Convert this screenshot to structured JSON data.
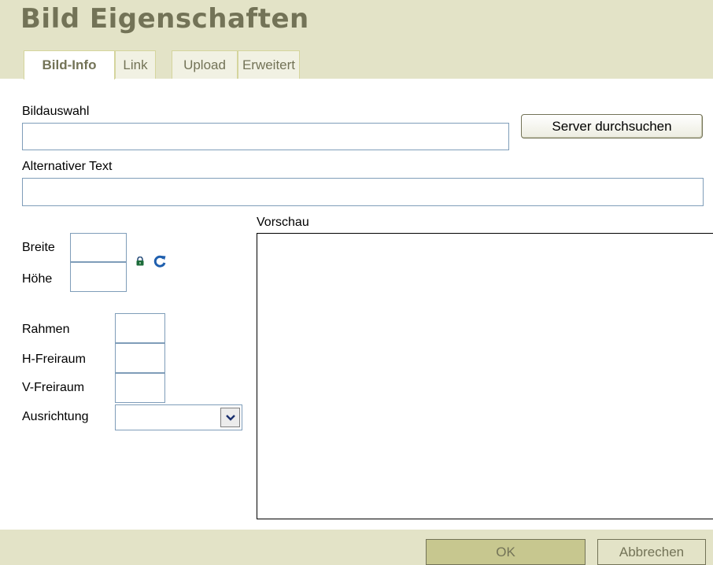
{
  "dialog": {
    "title": "Bild Eigenschaften",
    "tabs": [
      {
        "label": "Bild-Info",
        "active": true
      },
      {
        "label": "Link",
        "active": false
      },
      {
        "label": "Upload",
        "active": false
      },
      {
        "label": "Erweitert",
        "active": false
      }
    ]
  },
  "form": {
    "bildauswahl_label": "Bildauswahl",
    "bildauswahl_value": "",
    "server_button": "Server durchsuchen",
    "alt_text_label": "Alternativer Text",
    "alt_text_value": "",
    "preview_label": "Vorschau",
    "breite_label": "Breite",
    "breite_value": "",
    "hoehe_label": "Höhe",
    "hoehe_value": "",
    "lock_icon": "lock-icon",
    "reset_icon": "reset-size-icon",
    "rahmen_label": "Rahmen",
    "rahmen_value": "",
    "hfreiraum_label": "H-Freiraum",
    "hfreiraum_value": "",
    "vfreiraum_label": "V-Freiraum",
    "vfreiraum_value": "",
    "ausrichtung_label": "Ausrichtung",
    "ausrichtung_value": ""
  },
  "footer": {
    "ok_label": "OK",
    "cancel_label": "Abbrechen"
  },
  "colors": {
    "header_bg": "#e3e3c7",
    "title_text": "#737357",
    "ok_button_bg": "#c7c78f",
    "field_border": "#7f9db9"
  }
}
